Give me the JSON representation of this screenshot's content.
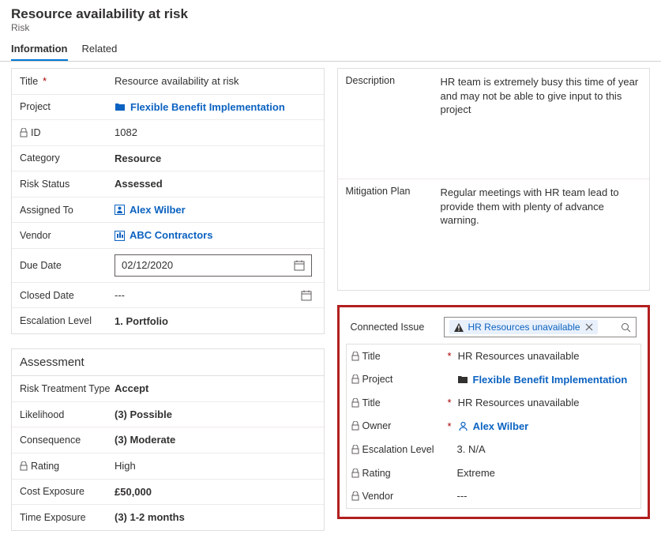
{
  "header": {
    "title": "Resource availability at risk",
    "subtitle": "Risk"
  },
  "tabs": {
    "information": "Information",
    "related": "Related"
  },
  "fields": {
    "title_label": "Title",
    "title_value": "Resource availability at risk",
    "project_label": "Project",
    "project_value": "Flexible Benefit Implementation",
    "id_label": "ID",
    "id_value": "1082",
    "category_label": "Category",
    "category_value": "Resource",
    "risk_status_label": "Risk Status",
    "risk_status_value": "Assessed",
    "assigned_to_label": "Assigned To",
    "assigned_to_value": "Alex Wilber",
    "vendor_label": "Vendor",
    "vendor_value": "ABC Contractors",
    "due_date_label": "Due Date",
    "due_date_value": "02/12/2020",
    "closed_date_label": "Closed Date",
    "closed_date_value": "---",
    "escalation_label": "Escalation Level",
    "escalation_value": "1. Portfolio"
  },
  "assessment": {
    "heading": "Assessment",
    "risk_treatment_label": "Risk Treatment Type",
    "risk_treatment_value": "Accept",
    "likelihood_label": "Likelihood",
    "likelihood_value": "(3) Possible",
    "consequence_label": "Consequence",
    "consequence_value": "(3) Moderate",
    "rating_label": "Rating",
    "rating_value": "High",
    "cost_label": "Cost Exposure",
    "cost_value": "£50,000",
    "time_label": "Time Exposure",
    "time_value": "(3) 1-2 months"
  },
  "right": {
    "description_label": "Description",
    "description_value": "HR team is extremely busy this time of year and may not be able to give input to this project",
    "mitigation_label": "Mitigation Plan",
    "mitigation_value": "Regular meetings with HR team lead to provide them with plenty of advance warning."
  },
  "connected": {
    "label": "Connected Issue",
    "chip": "HR Resources unavailable",
    "title_label": "Title",
    "title_value": "HR Resources unavailable",
    "project_label": "Project",
    "project_value": "Flexible Benefit Implementation",
    "title2_label": "Title",
    "title2_value": "HR Resources unavailable",
    "owner_label": "Owner",
    "owner_value": "Alex Wilber",
    "escalation_label": "Escalation Level",
    "escalation_value": "3. N/A",
    "rating_label": "Rating",
    "rating_value": "Extreme",
    "vendor_label": "Vendor",
    "vendor_value": "---"
  }
}
